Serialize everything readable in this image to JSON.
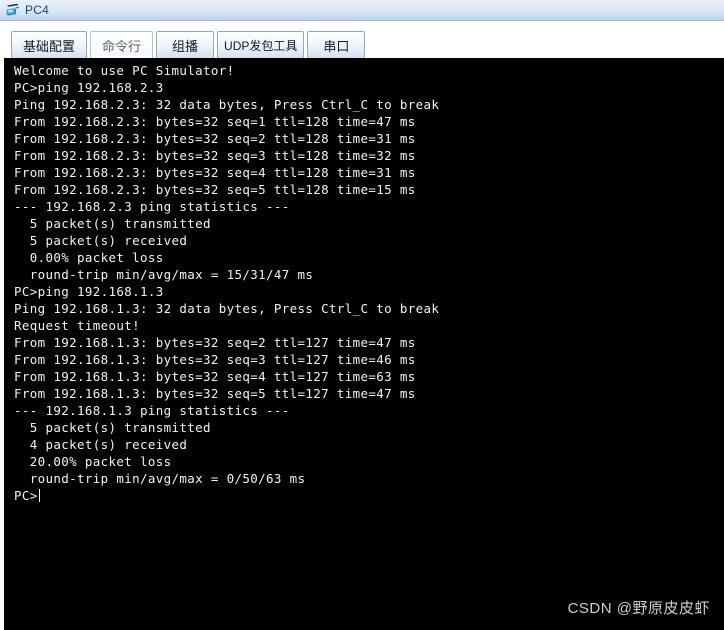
{
  "window": {
    "title": "PC4",
    "icon": "pc-host-icon"
  },
  "tabs": [
    {
      "label": "基础配置",
      "active": false
    },
    {
      "label": "命令行",
      "active": true
    },
    {
      "label": "组播",
      "active": false
    },
    {
      "label": "UDP发包工具",
      "active": false
    },
    {
      "label": "串口",
      "active": false
    }
  ],
  "terminal": {
    "lines": [
      "Welcome to use PC Simulator!",
      "",
      "PC>ping 192.168.2.3",
      "",
      "Ping 192.168.2.3: 32 data bytes, Press Ctrl_C to break",
      "From 192.168.2.3: bytes=32 seq=1 ttl=128 time=47 ms",
      "From 192.168.2.3: bytes=32 seq=2 ttl=128 time=31 ms",
      "From 192.168.2.3: bytes=32 seq=3 ttl=128 time=32 ms",
      "From 192.168.2.3: bytes=32 seq=4 ttl=128 time=31 ms",
      "From 192.168.2.3: bytes=32 seq=5 ttl=128 time=15 ms",
      "",
      "--- 192.168.2.3 ping statistics ---",
      "  5 packet(s) transmitted",
      "  5 packet(s) received",
      "  0.00% packet loss",
      "  round-trip min/avg/max = 15/31/47 ms",
      "",
      "PC>ping 192.168.1.3",
      "",
      "Ping 192.168.1.3: 32 data bytes, Press Ctrl_C to break",
      "Request timeout!",
      "From 192.168.1.3: bytes=32 seq=2 ttl=127 time=47 ms",
      "From 192.168.1.3: bytes=32 seq=3 ttl=127 time=46 ms",
      "From 192.168.1.3: bytes=32 seq=4 ttl=127 time=63 ms",
      "From 192.168.1.3: bytes=32 seq=5 ttl=127 time=47 ms",
      "",
      "--- 192.168.1.3 ping statistics ---",
      "  5 packet(s) transmitted",
      "  4 packet(s) received",
      "  20.00% packet loss",
      "  round-trip min/avg/max = 0/50/63 ms",
      "",
      ""
    ],
    "prompt": "PC>",
    "input_value": ""
  },
  "watermark": {
    "text": "CSDN @野原皮皮虾"
  },
  "colors": {
    "titlebar_text": "#15457e",
    "terminal_bg": "#000000",
    "terminal_text": "#f2f2f2",
    "watermark_text": "#cfcfcf"
  }
}
